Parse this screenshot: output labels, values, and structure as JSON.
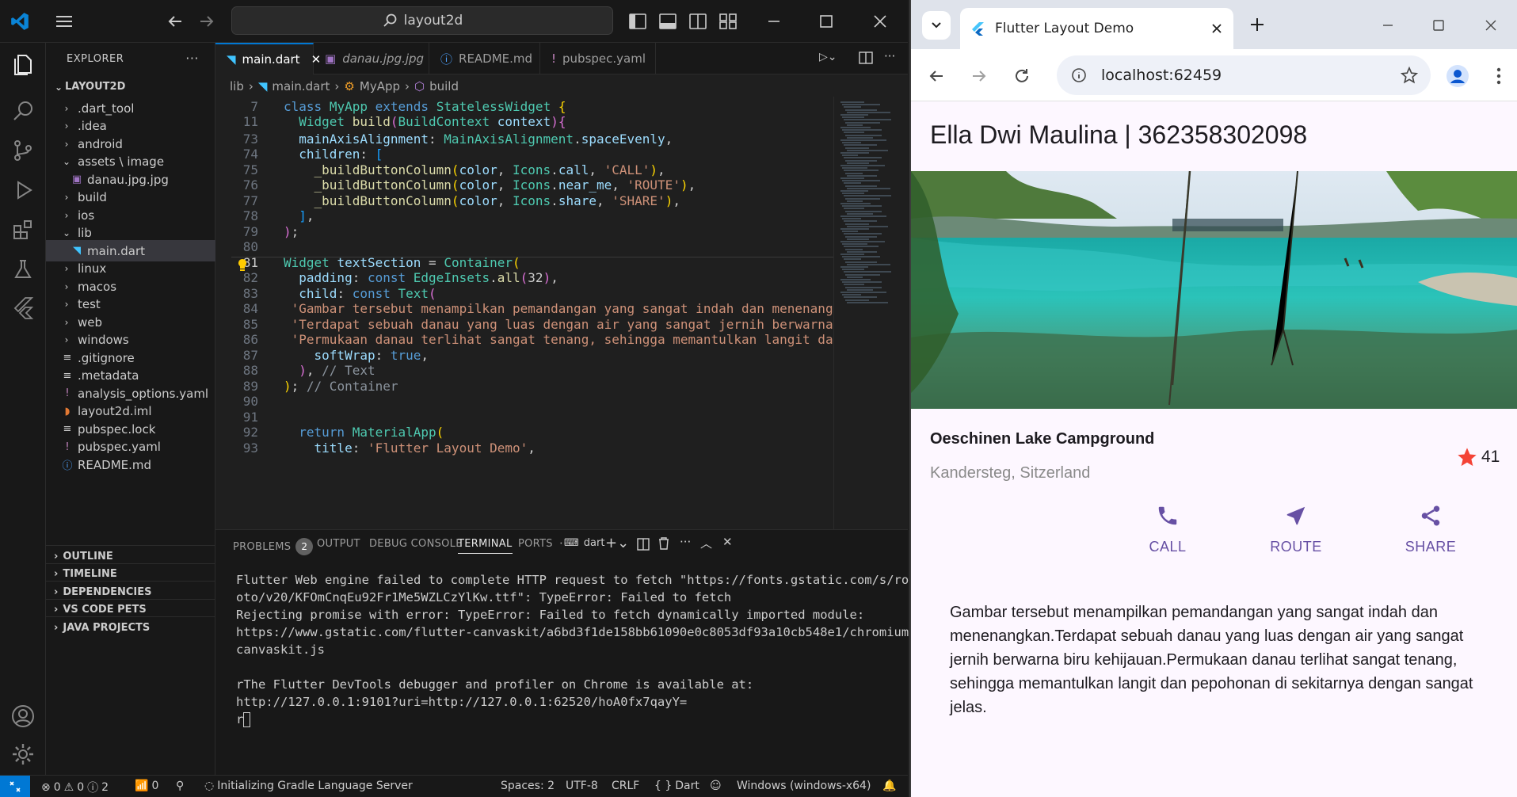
{
  "vscode": {
    "search_text": "layout2d",
    "explorer_title": "EXPLORER",
    "root_folder": "LAYOUT2D",
    "tree": [
      {
        "label": ".dart_tool",
        "kind": "folder"
      },
      {
        "label": ".idea",
        "kind": "folder"
      },
      {
        "label": "android",
        "kind": "folder"
      },
      {
        "label": "assets \\ image",
        "kind": "folder-open"
      },
      {
        "label": "danau.jpg.jpg",
        "kind": "image"
      },
      {
        "label": "build",
        "kind": "folder"
      },
      {
        "label": "ios",
        "kind": "folder"
      },
      {
        "label": "lib",
        "kind": "folder-open"
      },
      {
        "label": "main.dart",
        "kind": "dart"
      },
      {
        "label": "linux",
        "kind": "folder"
      },
      {
        "label": "macos",
        "kind": "folder"
      },
      {
        "label": "test",
        "kind": "folder"
      },
      {
        "label": "web",
        "kind": "folder"
      },
      {
        "label": "windows",
        "kind": "folder"
      },
      {
        "label": ".gitignore",
        "kind": "file"
      },
      {
        "label": ".metadata",
        "kind": "file"
      },
      {
        "label": "analysis_options.yaml",
        "kind": "yaml"
      },
      {
        "label": "layout2d.iml",
        "kind": "rss"
      },
      {
        "label": "pubspec.lock",
        "kind": "file"
      },
      {
        "label": "pubspec.yaml",
        "kind": "yaml"
      },
      {
        "label": "README.md",
        "kind": "info"
      }
    ],
    "sections": [
      "OUTLINE",
      "TIMELINE",
      "DEPENDENCIES",
      "VS CODE PETS",
      "JAVA PROJECTS"
    ],
    "tabs": [
      {
        "label": "main.dart",
        "active": true
      },
      {
        "label": "danau.jpg.jpg",
        "active": false
      },
      {
        "label": "README.md",
        "active": false
      },
      {
        "label": "pubspec.yaml",
        "active": false
      }
    ],
    "breadcrumb": [
      "lib",
      "main.dart",
      "MyApp",
      "build"
    ],
    "code_lines": [
      {
        "n": "7",
        "html": "<span class='kw'>class</span> <span class='ty'>MyApp</span> <span class='kw'>extends</span> <span class='ty'>StatelessWidget</span> <span class='br'>{</span>"
      },
      {
        "n": "11",
        "html": "  <span class='ty'>Widget</span> <span class='fn'>build</span><span class='br2'>(</span><span class='ty'>BuildContext</span> <span class='vr'>context</span><span class='br2'>)</span><span class='br2'>{</span>"
      },
      {
        "n": "73",
        "html": "  <span class='vr'>mainAxisAlignment</span>: <span class='ty'>MainAxisAlignment</span>.<span class='vr'>spaceEvenly</span>,"
      },
      {
        "n": "74",
        "html": "  <span class='vr'>children</span>: <span class='br3'>[</span>"
      },
      {
        "n": "75",
        "html": "    <span class='fn'>_buildButtonColumn</span><span class='br'>(</span><span class='vr'>color</span>, <span class='ty'>Icons</span>.<span class='vr'>call</span>, <span class='st'>'CALL'</span><span class='br'>)</span>,"
      },
      {
        "n": "76",
        "html": "    <span class='fn'>_buildButtonColumn</span><span class='br'>(</span><span class='vr'>color</span>, <span class='ty'>Icons</span>.<span class='vr'>near_me</span>, <span class='st'>'ROUTE'</span><span class='br'>)</span>,"
      },
      {
        "n": "77",
        "html": "    <span class='fn'>_buildButtonColumn</span><span class='br'>(</span><span class='vr'>color</span>, <span class='ty'>Icons</span>.<span class='vr'>share</span>, <span class='st'>'SHARE'</span><span class='br'>)</span>,"
      },
      {
        "n": "78",
        "html": "  <span class='br3'>]</span>,"
      },
      {
        "n": "79",
        "html": "<span class='br2'>)</span>;"
      },
      {
        "n": "80",
        "html": ""
      },
      {
        "n": "81",
        "html": "<span class='ty'>Widget</span> <span class='vr'>textSection</span> = <span class='ty'>Container</span><span class='br'>(</span>"
      },
      {
        "n": "82",
        "html": "  <span class='vr'>padding</span>: <span class='kw'>const</span> <span class='ty'>EdgeInsets</span>.<span class='fn'>all</span><span class='br2'>(</span>32<span class='br2'>)</span>,"
      },
      {
        "n": "83",
        "html": "  <span class='vr'>child</span>: <span class='kw'>const</span> <span class='ty'>Text</span><span class='br2'>(</span>"
      },
      {
        "n": "84",
        "html": " <span class='st'>'Gambar tersebut menampilkan pemandangan yang sangat indah dan menenang</span>"
      },
      {
        "n": "85",
        "html": " <span class='st'>'Terdapat sebuah danau yang luas dengan air yang sangat jernih berwarna</span>"
      },
      {
        "n": "86",
        "html": " <span class='st'>'Permukaan danau terlihat sangat tenang, sehingga memantulkan langit da</span>"
      },
      {
        "n": "87",
        "html": "    <span class='vr'>softWrap</span>: <span class='kw'>true</span>,"
      },
      {
        "n": "88",
        "html": "  <span class='br2'>)</span>, <span class='cm'>// Text</span>"
      },
      {
        "n": "89",
        "html": "<span class='br'>)</span>; <span class='cm'>// Container</span>"
      },
      {
        "n": "90",
        "html": ""
      },
      {
        "n": "91",
        "html": ""
      },
      {
        "n": "92",
        "html": "  <span class='kw'>return</span> <span class='ty'>MaterialApp</span><span class='br'>(</span>"
      },
      {
        "n": "93",
        "html": "    <span class='vr'>title</span>: <span class='st'>'Flutter Layout Demo'</span>,"
      }
    ],
    "current_line": "81",
    "panel_tabs": [
      "PROBLEMS",
      "OUTPUT",
      "DEBUG CONSOLE",
      "TERMINAL",
      "PORTS"
    ],
    "problems_count": "2",
    "terminal_shell": "dart",
    "terminal_lines": [
      "Flutter Web engine failed to complete HTTP request to fetch \"https://fonts.gstatic.com/s/rob",
      "oto/v20/KFOmCnqEu92Fr1Me5WZLCzYlKw.ttf\": TypeError: Failed to fetch",
      "Rejecting promise with error: TypeError: Failed to fetch dynamically imported module:",
      "https://www.gstatic.com/flutter-canvaskit/a6bd3f1de158bb61090e0c8053df93a10cb548e1/chromium/",
      "canvaskit.js",
      "",
      "rThe Flutter DevTools debugger and profiler on Chrome is available at:",
      "http://127.0.0.1:9101?uri=http://127.0.0.1:62520/hoA0fx7qayY=",
      "r"
    ],
    "status": {
      "errors": "0",
      "warnings": "0",
      "infos": "2",
      "ports": "0",
      "task": "Initializing Gradle Language Server",
      "spaces": "Spaces: 2",
      "encoding": "UTF-8",
      "eol": "CRLF",
      "language": "Dart",
      "device": "Windows (windows-x64)"
    }
  },
  "chrome": {
    "tab_title": "Flutter Layout Demo",
    "url": "localhost:62459",
    "app_title": "Ella Dwi Maulina | 362358302098",
    "place_name": "Oeschinen Lake Campground",
    "place_location": "Kandersteg, Sitzerland",
    "rating": "41",
    "actions": [
      "CALL",
      "ROUTE",
      "SHARE"
    ],
    "description": "Gambar tersebut menampilkan pemandangan yang sangat indah dan menenangkan.Terdapat sebuah danau yang luas dengan air yang sangat jernih berwarna biru kehijauan.Permukaan danau terlihat sangat tenang, sehingga memantulkan langit dan pepohonan di sekitarnya dengan sangat jelas.",
    "colors": {
      "accent": "#6750a4",
      "star": "#f44336",
      "surface": "#fdf7ff"
    }
  }
}
